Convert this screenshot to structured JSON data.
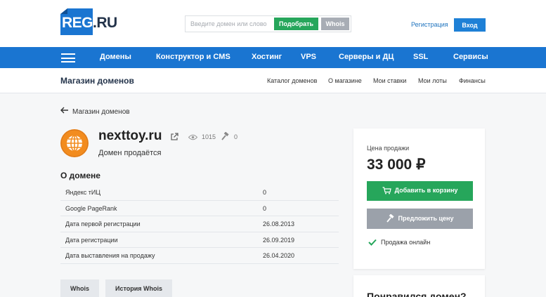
{
  "header": {
    "logo_text": "REG",
    "logo_suffix": ".RU",
    "search_placeholder": "Введите домен или слово",
    "pick_button": "Подобрать",
    "whois_button": "Whois",
    "register_link": "Регистрация",
    "login_button": "Вход"
  },
  "nav": {
    "items": [
      "Домены",
      "Конструктор и CMS",
      "Хостинг",
      "VPS",
      "Серверы и ДЦ",
      "SSL",
      "Сервисы"
    ]
  },
  "subheader": {
    "title": "Магазин доменов",
    "links": [
      "Каталог доменов",
      "О магазине",
      "Мои ставки",
      "Мои лоты",
      "Финансы"
    ]
  },
  "page": {
    "back_link": "Магазин доменов",
    "domain": "nexttoy.ru",
    "views": "1015",
    "bids": "0",
    "status": "Домен продаётся",
    "about_title": "О домене",
    "about": [
      {
        "key": "Яндекс тИЦ",
        "value": "0"
      },
      {
        "key": "Google PageRank",
        "value": "0"
      },
      {
        "key": "Дата первой регистрации",
        "value": "26.08.2013"
      },
      {
        "key": "Дата регистрации",
        "value": "26.09.2019"
      },
      {
        "key": "Дата выставления на продажу",
        "value": "26.04.2020"
      }
    ],
    "whois_button": "Whois",
    "history_button": "История Whois"
  },
  "card": {
    "price_label": "Цена продажи",
    "price": "33 000 ₽",
    "cart_button": "Добавить в корзину",
    "offer_button": "Предложить цену",
    "online_label": "Продажа онлайн"
  },
  "card2": {
    "title": "Понравился домен?"
  },
  "colors": {
    "brand_blue": "#1a75d1",
    "green": "#26a65b",
    "gray_button": "#9ba1aa",
    "logo_orange": "#f28c1f"
  }
}
